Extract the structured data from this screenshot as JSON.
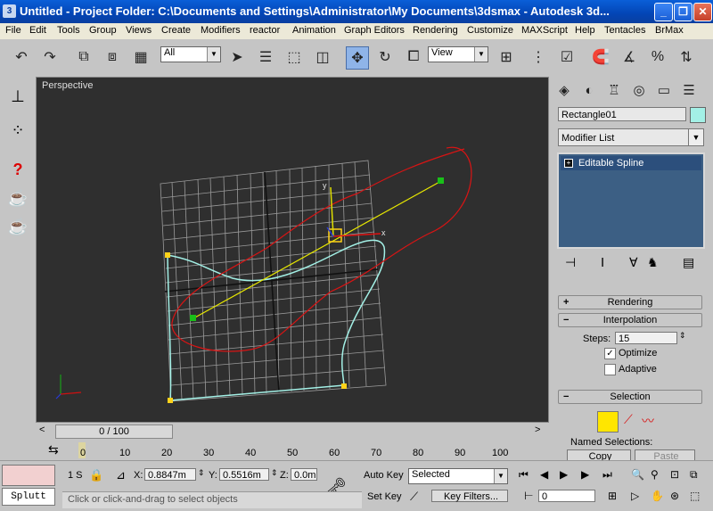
{
  "window": {
    "title": "Untitled     - Project Folder: C:\\Documents and Settings\\Administrator\\My Documents\\3dsmax     - Autodesk 3d...",
    "minimize_label": "_",
    "restore_label": "❐",
    "close_label": "✕"
  },
  "menu": [
    "File",
    "Edit",
    "Tools",
    "Group",
    "Views",
    "Create",
    "Modifiers",
    "reactor",
    "Animation",
    "Graph Editors",
    "Rendering",
    "Customize",
    "MAXScript",
    "Help",
    "Tentacles",
    "BrMax"
  ],
  "toolbar": {
    "selection_filter": "All",
    "ref_coord": "View",
    "icons": [
      "undo-icon",
      "redo-icon",
      "select-link-icon",
      "unlink-icon",
      "bind-spacewarp-icon",
      "select-object-icon",
      "select-by-name-icon",
      "rect-selection-icon",
      "window-crossing-icon",
      "move-icon",
      "rotate-icon",
      "scale-icon",
      "pivot-icon",
      "mirror-icon",
      "align-icon",
      "named-selection-icon",
      "magnet-snap-icon",
      "angle-snap-icon",
      "percent-snap-icon",
      "spinner-snap-icon"
    ]
  },
  "viewport": {
    "label": "Perspective"
  },
  "command_panel": {
    "object_name": "Rectangle01",
    "object_color": "#a3f0e6",
    "modifier_list": "Modifier List",
    "stack_items": [
      "Editable Spline"
    ],
    "rollouts": {
      "rendering": "Rendering",
      "interpolation": "Interpolation",
      "selection": "Selection"
    },
    "steps_label": "Steps:",
    "steps_value": "15",
    "optimize_label": "Optimize",
    "optimize_checked": true,
    "adaptive_label": "Adaptive",
    "adaptive_checked": false,
    "named_selections_label": "Named Selections:",
    "copy_label": "Copy",
    "paste_label": "Paste"
  },
  "timeline": {
    "frame_display": "0 / 100",
    "ticks": [
      "0",
      "10",
      "20",
      "30",
      "40",
      "50",
      "60",
      "70",
      "80",
      "90",
      "100"
    ]
  },
  "status": {
    "script_label": "Splutt",
    "selection_count": "1 S",
    "x_label": "X:",
    "x_value": "0.8847m",
    "y_label": "Y:",
    "y_value": "0.5516m",
    "z_label": "Z:",
    "z_value": "0.0m",
    "auto_key": "Auto Key",
    "key_mode": "Selected",
    "set_key": "Set Key",
    "key_filters": "Key Filters...",
    "current_frame": "0",
    "prompt": "Click or click-and-drag to select objects"
  }
}
